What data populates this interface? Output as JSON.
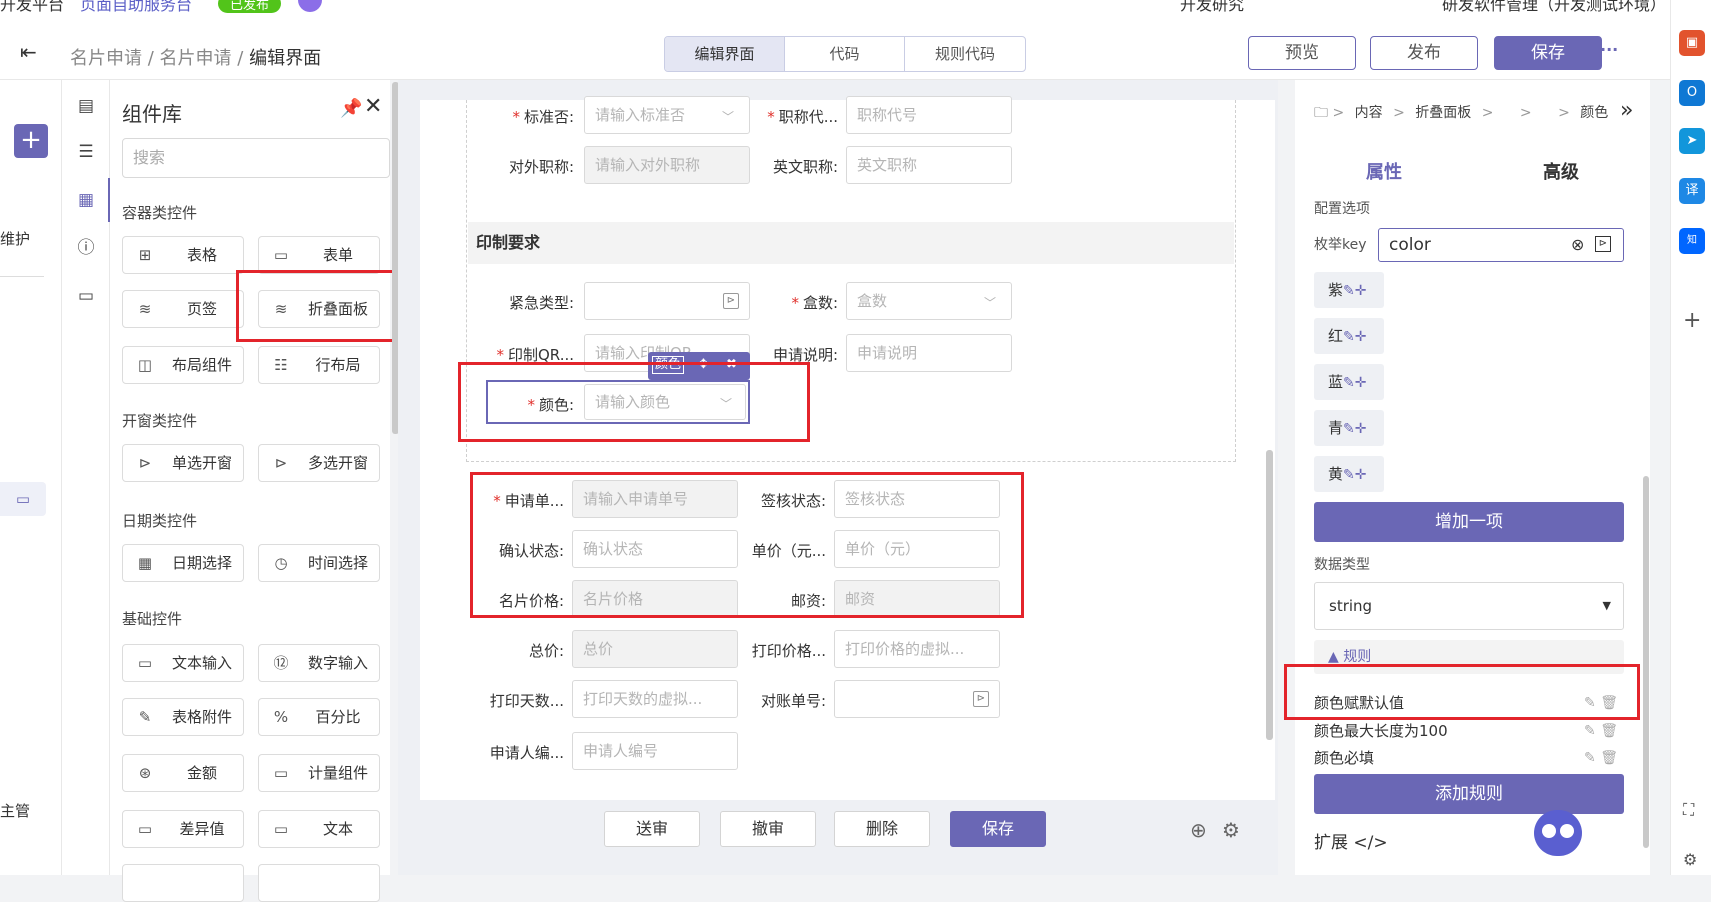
{
  "topbar": {
    "app_partial": "开发平台",
    "service": "页面自助服务台",
    "badge": "已发布",
    "right_a": "开发研究",
    "right_b": "研发软件管理（开发测试环境）"
  },
  "breadcrumb": {
    "a": "名片申请",
    "b": "名片申请",
    "c": "编辑界面",
    "sep": "/"
  },
  "segments": [
    "编辑界面",
    "代码",
    "规则代码"
  ],
  "header_buttons": {
    "preview": "预览",
    "publish": "发布",
    "save": "保存",
    "more": "···"
  },
  "left_nav": {
    "item1": "维护",
    "item2": "主管"
  },
  "library": {
    "title": "组件库",
    "search_placeholder": "搜索",
    "sections": [
      {
        "title": "容器类控件",
        "items": [
          {
            "label": "表格",
            "icon": "table-icon"
          },
          {
            "label": "表单",
            "icon": "form-icon"
          },
          {
            "label": "页签",
            "icon": "tabs-icon"
          },
          {
            "label": "折叠面板",
            "icon": "collapse-icon"
          },
          {
            "label": "布局组件",
            "icon": "layout-icon"
          },
          {
            "label": "行布局",
            "icon": "row-layout-icon"
          }
        ]
      },
      {
        "title": "开窗类控件",
        "items": [
          {
            "label": "单选开窗",
            "icon": "window-icon"
          },
          {
            "label": "多选开窗",
            "icon": "window-icon"
          }
        ]
      },
      {
        "title": "日期类控件",
        "items": [
          {
            "label": "日期选择",
            "icon": "calendar-icon"
          },
          {
            "label": "时间选择",
            "icon": "clock-icon"
          }
        ]
      },
      {
        "title": "基础控件",
        "items": [
          {
            "label": "文本输入",
            "icon": "text-input-icon"
          },
          {
            "label": "数字输入",
            "icon": "number-input-icon"
          },
          {
            "label": "表格附件",
            "icon": "attachment-icon"
          },
          {
            "label": "百分比",
            "icon": "percent-icon"
          },
          {
            "label": "金额",
            "icon": "amount-icon"
          },
          {
            "label": "计量组件",
            "icon": "measure-icon"
          },
          {
            "label": "差异值",
            "icon": "diff-icon"
          },
          {
            "label": "文本",
            "icon": "text-icon"
          }
        ]
      }
    ]
  },
  "form": {
    "row_top": [
      {
        "label": "标准否:",
        "required": true,
        "placeholder": "请输入标准否",
        "type": "select"
      },
      {
        "label": "职称代...",
        "required": true,
        "placeholder": "职称代号",
        "type": "text"
      },
      {
        "label": "对外职称:",
        "required": false,
        "placeholder": "请输入对外职称",
        "type": "disabled"
      },
      {
        "label": "英文职称:",
        "required": false,
        "placeholder": "英文职称",
        "type": "text"
      }
    ],
    "section_title": "印制要求",
    "print_fields": [
      {
        "label": "紧急类型:",
        "required": false,
        "placeholder": "",
        "type": "window"
      },
      {
        "label": "盒数:",
        "required": true,
        "placeholder": "盒数",
        "type": "select"
      },
      {
        "label": "印制QR...",
        "required": true,
        "placeholder": "请输入印制QR",
        "type": "text"
      },
      {
        "label": "申请说明:",
        "required": false,
        "placeholder": "申请说明",
        "type": "text"
      }
    ],
    "color_field": {
      "label": "颜色:",
      "placeholder": "请输入颜色",
      "toolbar_label": "颜色",
      "toolbar_move": "✥",
      "toolbar_close": "✖"
    },
    "apply_fields": [
      {
        "label": "申请单...",
        "required": true,
        "placeholder": "请输入申请单号",
        "type": "disabled"
      },
      {
        "label": "签核状态:",
        "required": false,
        "placeholder": "签核状态",
        "type": "text"
      },
      {
        "label": "确认状态:",
        "required": false,
        "placeholder": "确认状态",
        "type": "text"
      },
      {
        "label": "单价（元...",
        "required": false,
        "placeholder": "单价（元）",
        "type": "text"
      },
      {
        "label": "名片价格:",
        "required": false,
        "placeholder": "名片价格",
        "type": "disabled"
      },
      {
        "label": "邮资:",
        "required": false,
        "placeholder": "邮资",
        "type": "disabled"
      },
      {
        "label": "总价:",
        "required": false,
        "placeholder": "总价",
        "type": "disabled"
      },
      {
        "label": "打印价格...",
        "required": false,
        "placeholder": "打印价格的虚拟...",
        "type": "text"
      },
      {
        "label": "打印天数...",
        "required": false,
        "placeholder": "打印天数的虚拟...",
        "type": "text"
      },
      {
        "label": "对账单号:",
        "required": false,
        "placeholder": "",
        "type": "window"
      },
      {
        "label": "申请人编...",
        "required": false,
        "placeholder": "申请人编号",
        "type": "text"
      }
    ],
    "footer_buttons": [
      "送审",
      "撤审",
      "删除",
      "保存"
    ]
  },
  "right_panel": {
    "path": {
      "a": "内容",
      "b": "折叠面板",
      "c": "颜色",
      "sep": ">"
    },
    "tabs": {
      "attr": "属性",
      "adv": "高级"
    },
    "config_title": "配置选项",
    "enum_key_label": "枚举key",
    "enum_key_value": "color",
    "enum_items": [
      "紫",
      "红",
      "蓝",
      "青",
      "黄"
    ],
    "add_item": "增加一项",
    "data_type_label": "数据类型",
    "data_type_value": "string",
    "rules_title": "规则",
    "rules": [
      "颜色赋默认值",
      "颜色最大长度为100",
      "颜色必填"
    ],
    "add_rule": "添加规则",
    "extend": "扩展 </>"
  },
  "colors": {
    "accent": "#6a67b5",
    "required": "#e0312c",
    "highlight": "#e3242b"
  }
}
